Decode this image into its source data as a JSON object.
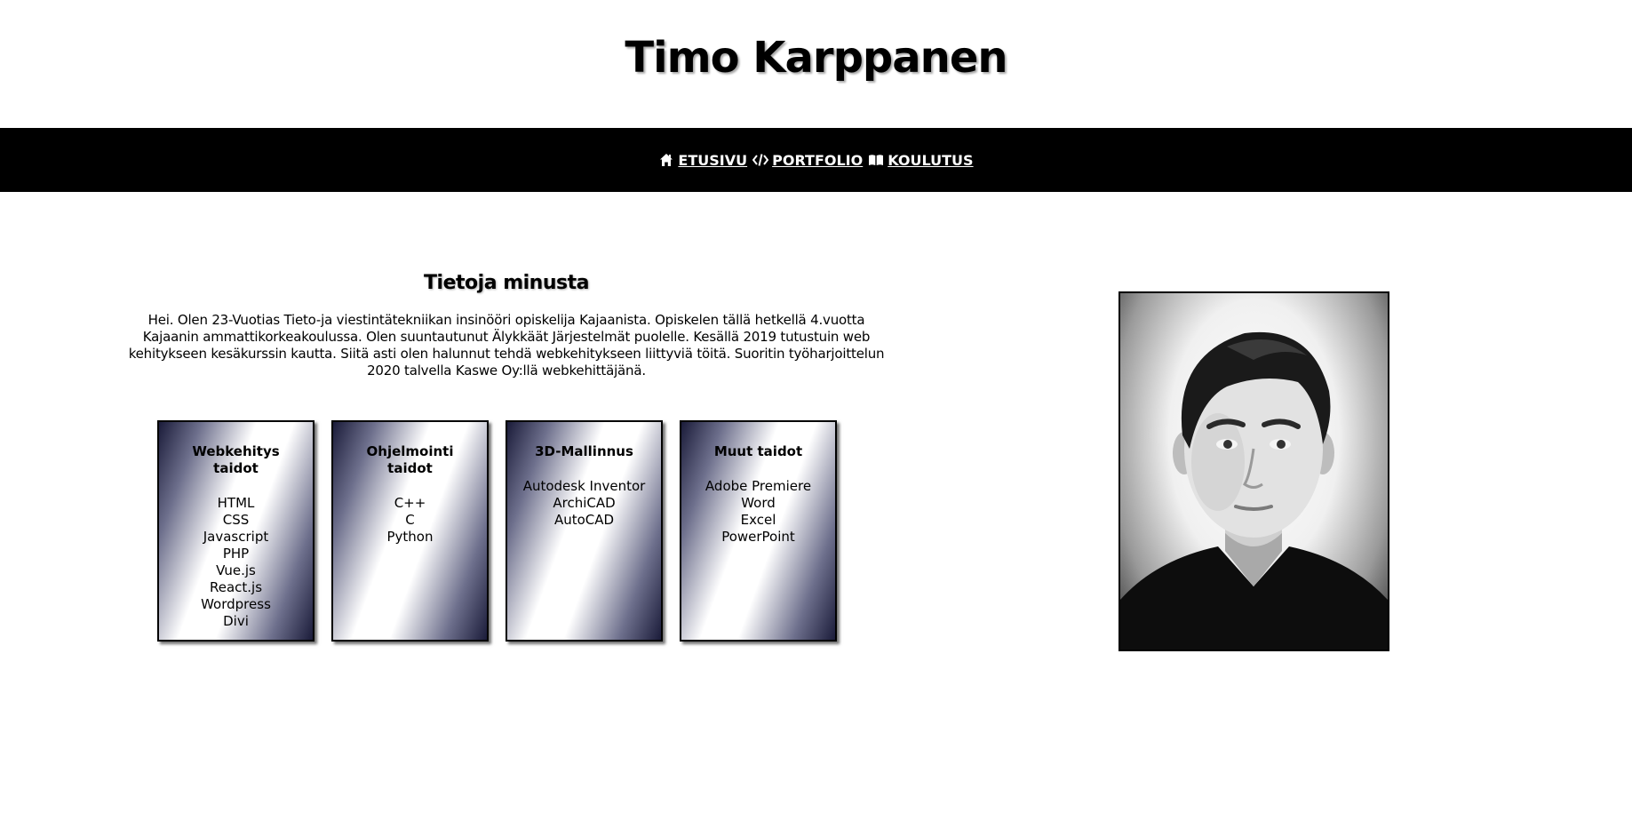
{
  "header": {
    "title": "Timo Karppanen"
  },
  "nav": {
    "items": [
      {
        "label": "ETUSIVU",
        "icon": "home-icon"
      },
      {
        "label": "PORTFOLIO",
        "icon": "code-icon"
      },
      {
        "label": "KOULUTUS",
        "icon": "book-icon"
      }
    ]
  },
  "about": {
    "title": "Tietoja minusta",
    "text": "Hei. Olen 23-Vuotias Tieto-ja viestintätekniikan insinööri opiskelija Kajaanista. Opiskelen tällä hetkellä 4.vuotta Kajaanin ammattikorkeakoulussa. Olen suuntautunut Älykkäät Järjestelmät puolelle. Kesällä 2019 tutustuin web kehitykseen kesäkurssin kautta. Siitä asti olen halunnut tehdä webkehitykseen liittyviä töitä. Suoritin työharjoittelun 2020 talvella Kaswe Oy:llä webkehittäjänä."
  },
  "skills": [
    {
      "title": "Webkehitys taidot",
      "items": [
        "HTML",
        "CSS",
        "Javascript",
        "PHP",
        "Vue.js",
        "React.js",
        "Wordpress",
        "Divi"
      ]
    },
    {
      "title": "Ohjelmointi taidot",
      "items": [
        "C++",
        "C",
        "Python"
      ]
    },
    {
      "title": "3D-Mallinnus",
      "items": [
        "Autodesk Inventor",
        "ArchiCAD",
        "AutoCAD"
      ]
    },
    {
      "title": "Muut taidot",
      "items": [
        "Adobe Premiere",
        "Word",
        "Excel",
        "PowerPoint"
      ]
    }
  ],
  "colors": {
    "nav_background": "#000000",
    "nav_text": "#ffffff",
    "card_gradient_dark": "#1b1c3a"
  }
}
